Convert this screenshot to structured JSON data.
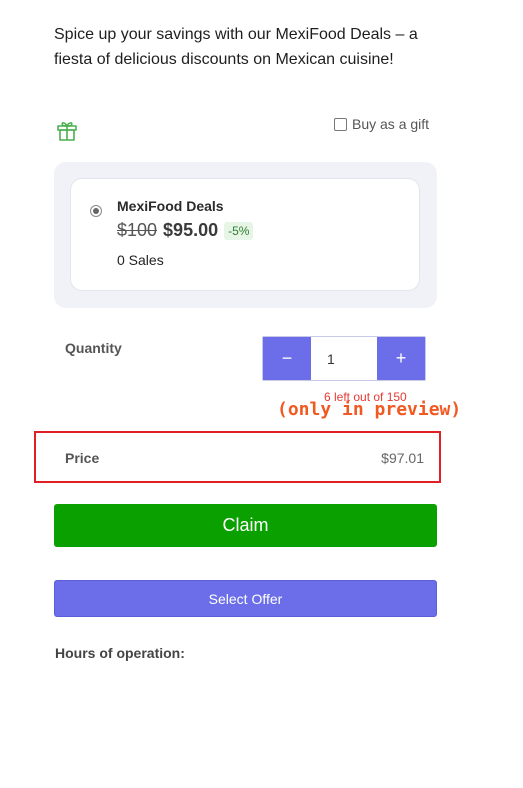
{
  "intro": {
    "text": "Spice up your savings with our MexiFood Deals – a fiesta of delicious discounts on Mexican cuisine!"
  },
  "gift": {
    "icon": "gift-icon",
    "label": "Buy as a gift",
    "checked": false
  },
  "deal": {
    "name": "MexiFood Deals",
    "original_price": "$100",
    "price": "$95.00",
    "discount": "-5%",
    "sales": "0 Sales",
    "selected": true
  },
  "quantity": {
    "label": "Quantity",
    "decrement": "−",
    "value": "1",
    "increment": "+",
    "stock_note": "6 left out of 150",
    "preview_note": "(only in preview)"
  },
  "price": {
    "label": "Price",
    "value": "$97.01"
  },
  "actions": {
    "claim": "Claim",
    "select_offer": "Select Offer"
  },
  "hours": {
    "label": "Hours of operation:"
  },
  "colors": {
    "accent": "#6b6ee8",
    "claim": "#0aa100",
    "highlight_border": "#e11f26",
    "stock_note": "#e53935",
    "gift_icon": "#4caf50"
  }
}
